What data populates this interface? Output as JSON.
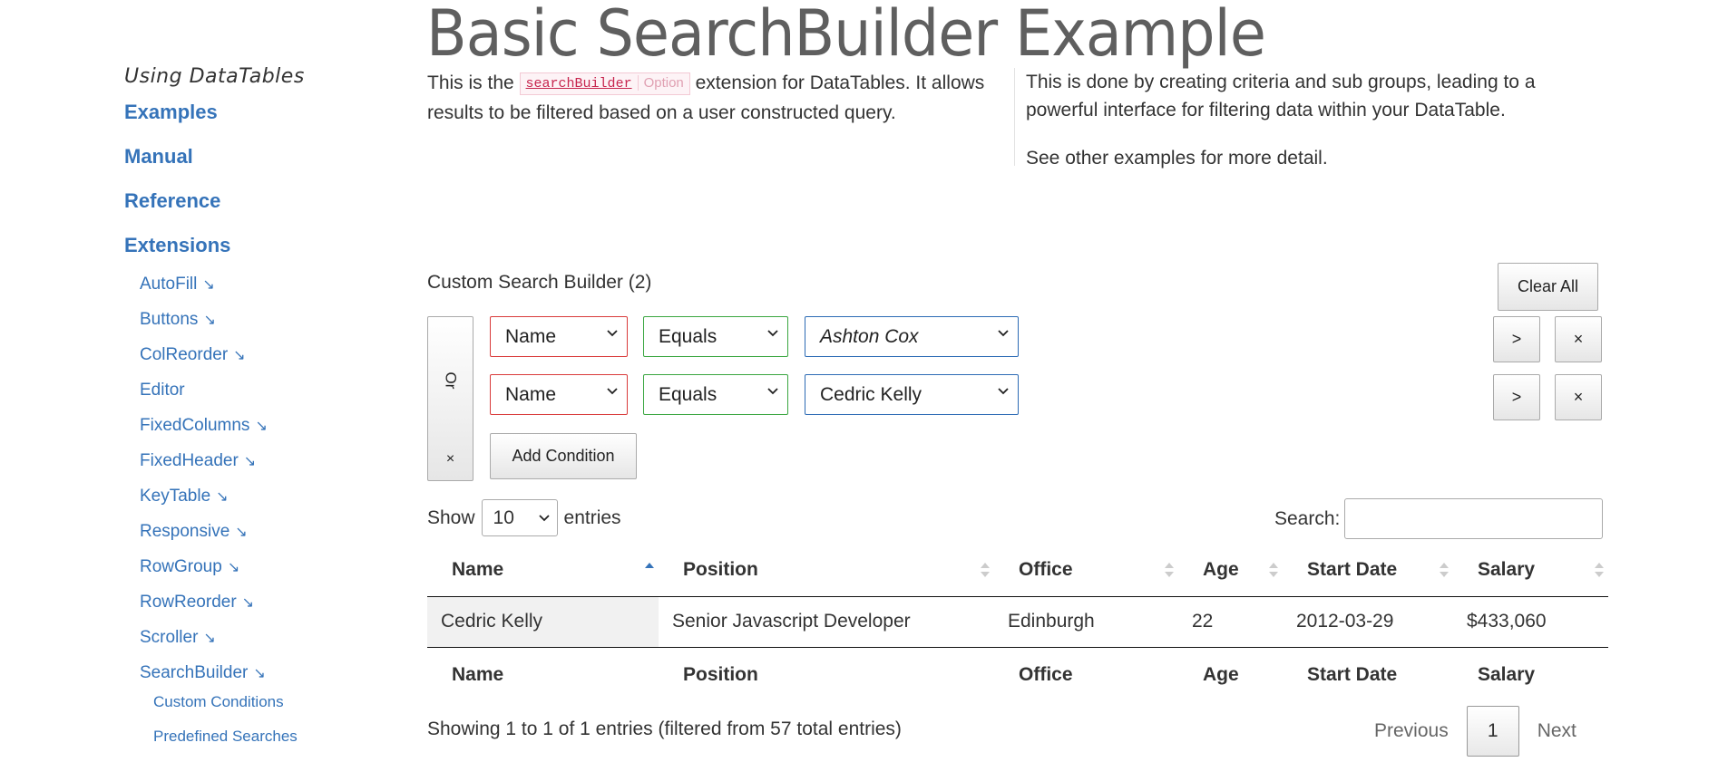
{
  "sidebar": {
    "heading": "Using DataTables",
    "main_links": [
      "Examples",
      "Manual",
      "Reference",
      "Extensions"
    ],
    "extensions": [
      {
        "label": "AutoFill",
        "arrow": "↘"
      },
      {
        "label": "Buttons",
        "arrow": "↘"
      },
      {
        "label": "ColReorder",
        "arrow": "↘"
      },
      {
        "label": "Editor",
        "arrow": ""
      },
      {
        "label": "FixedColumns",
        "arrow": "↘"
      },
      {
        "label": "FixedHeader",
        "arrow": "↘"
      },
      {
        "label": "KeyTable",
        "arrow": "↘"
      },
      {
        "label": "Responsive",
        "arrow": "↘"
      },
      {
        "label": "RowGroup",
        "arrow": "↘"
      },
      {
        "label": "RowReorder",
        "arrow": "↘"
      },
      {
        "label": "Scroller",
        "arrow": "↘"
      },
      {
        "label": "SearchBuilder",
        "arrow": "↘"
      }
    ],
    "searchbuilder_children": [
      "Custom Conditions",
      "Predefined Searches"
    ]
  },
  "page": {
    "title": "Basic SearchBuilder Example",
    "intro_left_before": "This is the",
    "intro_code_name": "searchBuilder",
    "intro_code_kind": "Option",
    "intro_left_after": "extension for DataTables. It allows results to be filtered based on a user constructed query.",
    "intro_right_p1": "This is done by creating criteria and sub groups, leading to a powerful interface for filtering data within your DataTable.",
    "intro_right_p2": "See other examples for more detail."
  },
  "search_builder": {
    "title": "Custom Search Builder (2)",
    "clear_all": "Clear All",
    "logic_label": "Or",
    "logic_remove": "×",
    "conditions": [
      {
        "column": "Name",
        "operator": "Equals",
        "value": "Ashton Cox",
        "indent": ">",
        "remove": "×"
      },
      {
        "column": "Name",
        "operator": "Equals",
        "value": "Cedric Kelly",
        "indent": ">",
        "remove": "×"
      }
    ],
    "add_condition": "Add Condition"
  },
  "table_controls": {
    "show_label": "Show",
    "length_value": "10",
    "entries_label": "entries",
    "search_label": "Search:",
    "search_value": ""
  },
  "table": {
    "columns": [
      "Name",
      "Position",
      "Office",
      "Age",
      "Start Date",
      "Salary"
    ],
    "rows": [
      [
        "Cedric Kelly",
        "Senior Javascript Developer",
        "Edinburgh",
        "22",
        "2012-03-29",
        "$433,060"
      ]
    ]
  },
  "info": "Showing 1 to 1 of 1 entries (filtered from 57 total entries)",
  "pagination": {
    "previous": "Previous",
    "current": "1",
    "next": "Next"
  },
  "colors": {
    "link": "#3573b9",
    "column_border": "#d93b3b",
    "operator_border": "#3aa640",
    "value_border": "#2d6bb5"
  }
}
